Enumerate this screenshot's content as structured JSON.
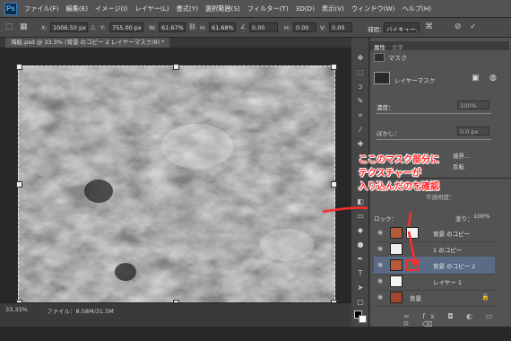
{
  "app": {
    "logo": "Ps"
  },
  "menu": [
    "ファイル(F)",
    "編集(E)",
    "イメージ(I)",
    "レイヤー(L)",
    "書式(Y)",
    "選択範囲(S)",
    "フィルター(T)",
    "3D(D)",
    "表示(V)",
    "ウィンドウ(W)",
    "ヘルプ(H)"
  ],
  "options": {
    "x_label": "X:",
    "x_value": "1006.50 px",
    "y_label": "Y:",
    "y_value": "755.00 px",
    "w_label": "W:",
    "w_value": "61.67%",
    "h_label": "H:",
    "h_value": "61.68%",
    "angle_value": "0.00",
    "h2_label": "H:",
    "h2_value": "0.00",
    "v_label": "V:",
    "v_value": "0.00",
    "interp_label": "補間：",
    "interp_value": "バイキュー…"
  },
  "document": {
    "tab_title": "海絵.psd @ 33.3% (背景 のコピー 2 レイヤーマスク/8) *"
  },
  "status": {
    "zoom": "33.33%",
    "file_info": "ファイル：8.58M/31.5M"
  },
  "properties": {
    "tab_props": "属性",
    "tab_text": "文字",
    "mask_title": "マスク",
    "layer_mask_label": "レイヤーマスク",
    "density_label": "濃度：",
    "density_value": "100%",
    "feather_label": "ぼかし：",
    "feather_value": "0.0 px",
    "refine_label": "境界…",
    "invert_label": "反転"
  },
  "layers": {
    "fill_label": "塗り：",
    "fill_value": "100%",
    "lock_label": "ロック：",
    "opacity_label": "不透明度：",
    "items": [
      {
        "name": "背景 のコピー"
      },
      {
        "name": "1 のコピー"
      },
      {
        "name": "背景 のコピー 2"
      },
      {
        "name": "レイヤー 1"
      },
      {
        "name": "背景"
      }
    ]
  },
  "annotation": {
    "line1": "ここのマスク部分に",
    "line2": "テクスチャーが",
    "line3": "入り込んだのを確認"
  },
  "colors": {
    "accent_red": "#ff2a2a",
    "selected_layer": "#5a6b85"
  }
}
